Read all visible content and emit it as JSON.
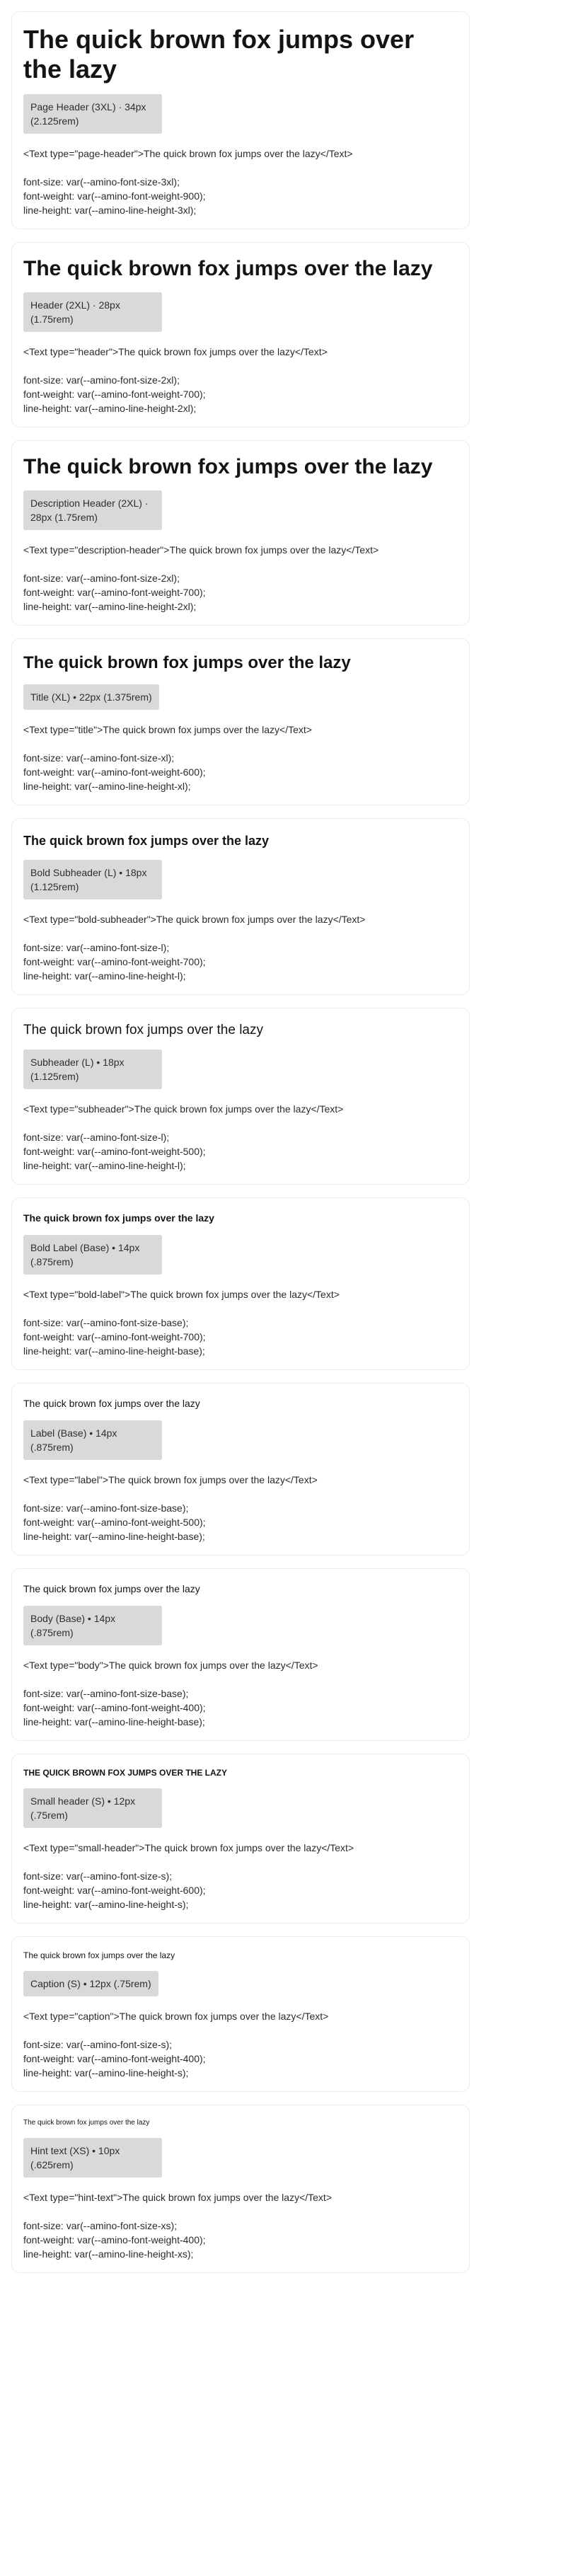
{
  "sample_text": "The quick brown fox jumps over the lazy",
  "cards": [
    {
      "key": "page-header",
      "badge": "Page Header (3XL) · 34px (2.125rem)",
      "code": "<Text type=\"page-header\">The quick brown fox jumps over the lazy</Text>",
      "props": "font-size: var(--amino-font-size-3xl);\nfont-weight: var(--amino-font-weight-900);\nline-height: var(--amino-line-height-3xl);"
    },
    {
      "key": "header",
      "badge": "Header (2XL) · 28px (1.75rem)",
      "code": "<Text type=\"header\">The quick brown fox jumps over the lazy</Text>",
      "props": "font-size: var(--amino-font-size-2xl);\nfont-weight: var(--amino-font-weight-700);\nline-height: var(--amino-line-height-2xl);"
    },
    {
      "key": "description-header",
      "badge": "Description Header (2XL) · 28px (1.75rem)",
      "code": "<Text type=\"description-header\">The quick brown fox jumps over the lazy</Text>",
      "props": "font-size: var(--amino-font-size-2xl);\nfont-weight: var(--amino-font-weight-700);\nline-height: var(--amino-line-height-2xl);"
    },
    {
      "key": "title",
      "badge": "Title (XL) • 22px (1.375rem)",
      "code": "<Text type=\"title\">The quick brown fox jumps over the lazy</Text>",
      "props": "font-size: var(--amino-font-size-xl);\nfont-weight: var(--amino-font-weight-600);\nline-height: var(--amino-line-height-xl);"
    },
    {
      "key": "bold-subheader",
      "badge": "Bold Subheader (L) • 18px (1.125rem)",
      "code": "<Text type=\"bold-subheader\">The quick brown fox jumps over the lazy</Text>",
      "props": "font-size: var(--amino-font-size-l);\nfont-weight: var(--amino-font-weight-700);\nline-height: var(--amino-line-height-l);"
    },
    {
      "key": "subheader",
      "badge": "Subheader (L) • 18px (1.125rem)",
      "code": "<Text type=\"subheader\">The quick brown fox jumps over the lazy</Text>",
      "props": "font-size: var(--amino-font-size-l);\nfont-weight: var(--amino-font-weight-500);\nline-height: var(--amino-line-height-l);"
    },
    {
      "key": "bold-label",
      "badge": "Bold Label (Base) • 14px (.875rem)",
      "code": "<Text type=\"bold-label\">The quick brown fox jumps over the lazy</Text>",
      "props": "font-size: var(--amino-font-size-base);\nfont-weight: var(--amino-font-weight-700);\nline-height: var(--amino-line-height-base);"
    },
    {
      "key": "label",
      "badge": "Label (Base) • 14px (.875rem)",
      "code": "<Text type=\"label\">The quick brown fox jumps over the lazy</Text>",
      "props": "font-size: var(--amino-font-size-base);\nfont-weight: var(--amino-font-weight-500);\nline-height: var(--amino-line-height-base);"
    },
    {
      "key": "body",
      "badge": "Body (Base) • 14px (.875rem)",
      "code": "<Text type=\"body\">The quick brown fox jumps over the lazy</Text>",
      "props": "font-size: var(--amino-font-size-base);\nfont-weight: var(--amino-font-weight-400);\nline-height: var(--amino-line-height-base);"
    },
    {
      "key": "small-header",
      "badge": "Small header (S) • 12px (.75rem)",
      "code": "<Text type=\"small-header\">The quick brown fox jumps over the lazy</Text>",
      "props": "font-size: var(--amino-font-size-s);\nfont-weight: var(--amino-font-weight-600);\nline-height: var(--amino-line-height-s);"
    },
    {
      "key": "caption",
      "badge": "Caption (S) • 12px (.75rem)",
      "code": "<Text type=\"caption\">The quick brown fox jumps over the lazy</Text>",
      "props": "font-size: var(--amino-font-size-s);\nfont-weight: var(--amino-font-weight-400);\nline-height: var(--amino-line-height-s);"
    },
    {
      "key": "hint-text",
      "badge": "Hint text (XS) • 10px (.625rem)",
      "code": "<Text type=\"hint-text\">The quick brown fox jumps over the lazy</Text>",
      "props": "font-size: var(--amino-font-size-xs);\nfont-weight: var(--amino-font-weight-400);\nline-height: var(--amino-line-height-xs);"
    }
  ]
}
